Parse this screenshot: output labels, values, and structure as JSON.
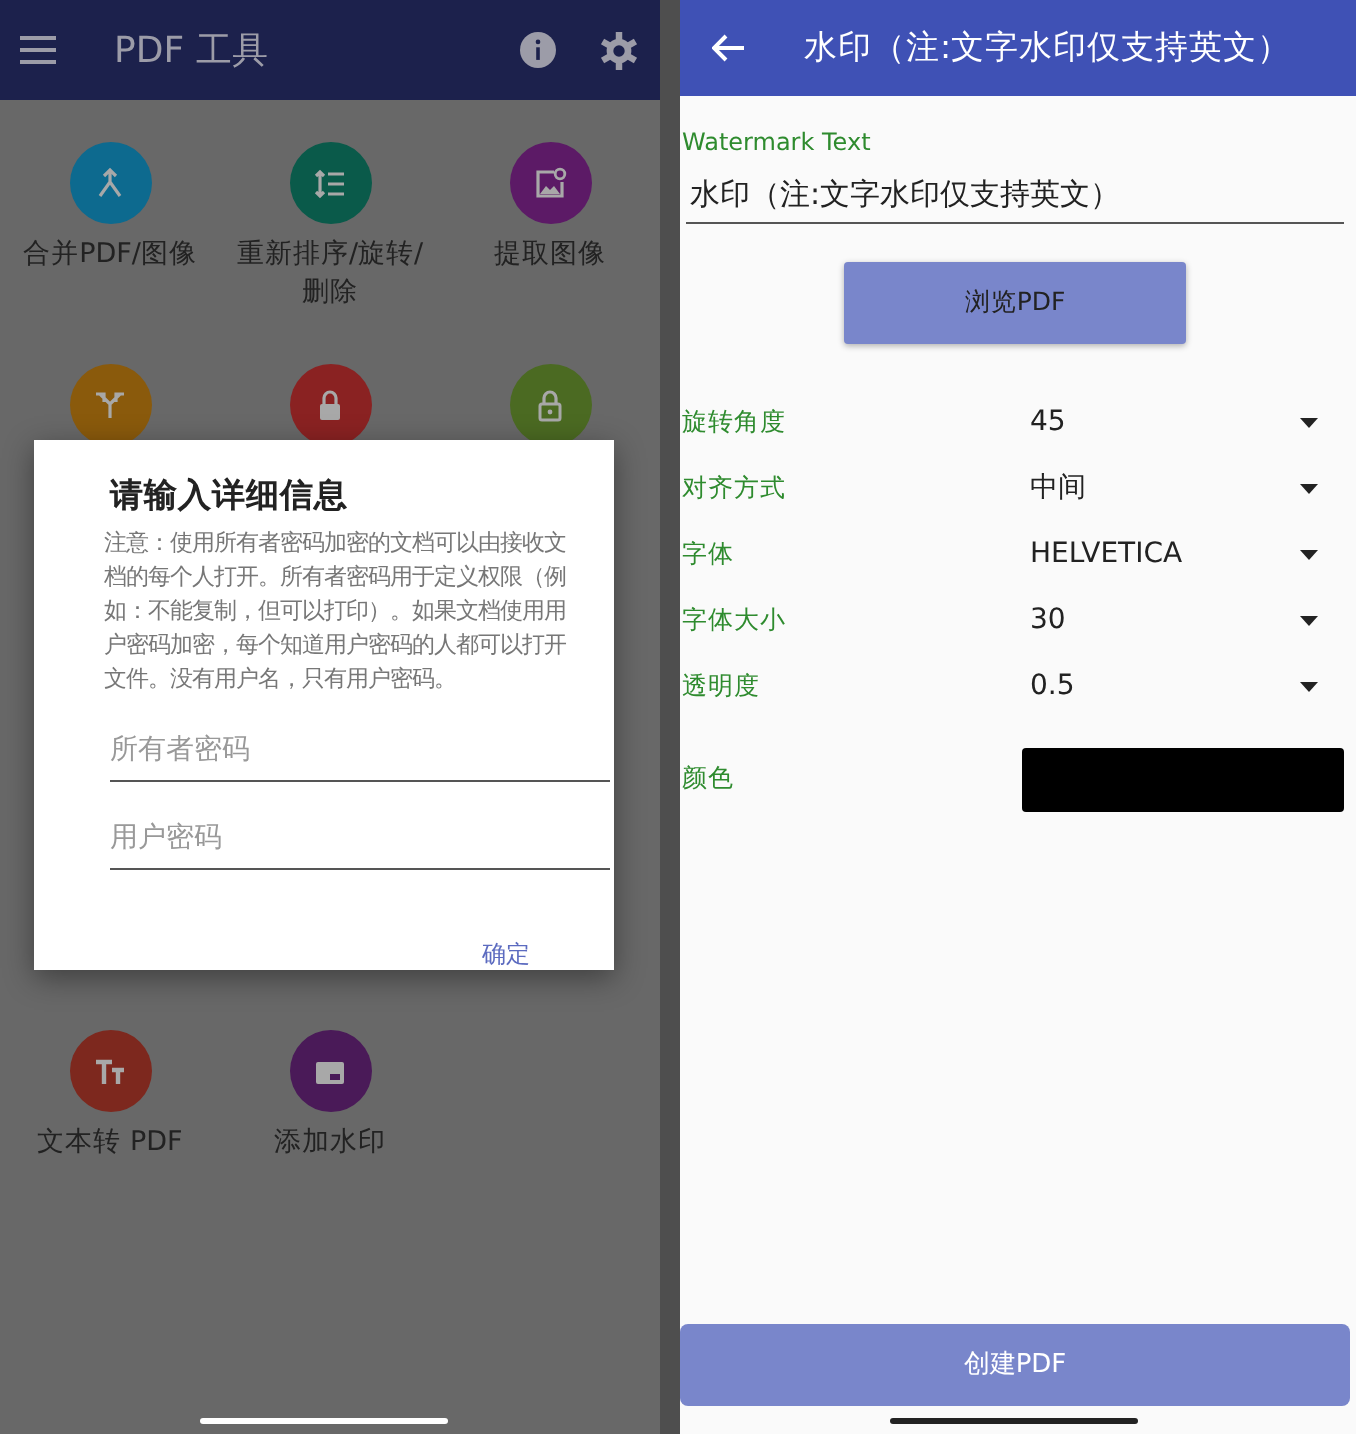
{
  "left_screen": {
    "app_bar": {
      "title": "PDF 工具"
    },
    "tools": [
      {
        "label": "合并PDF/图像",
        "color": "#0d6a8f"
      },
      {
        "label": "重新排序/旋转/删除",
        "color": "#0a5a4a"
      },
      {
        "label": "提取图像",
        "color": "#5c1a66"
      },
      {
        "color": "#8a5a0c"
      },
      {
        "color": "#8a2222"
      },
      {
        "color": "#4b6a22"
      },
      {
        "label": "文本转 PDF",
        "color": "#7d281e"
      },
      {
        "label": "添加水印",
        "color": "#4a1a58"
      }
    ],
    "dialog": {
      "title": "请输入详细信息",
      "message": "注意：使用所有者密码加密的文档可以由接收文档的每个人打开。所有者密码用于定义权限（例如：不能复制，但可以打印）。如果文档使用用户密码加密，每个知道用户密码的人都可以打开文件。没有用户名，只有用户密码。",
      "fields": [
        {
          "placeholder": "所有者密码"
        },
        {
          "placeholder": "用户密码"
        }
      ],
      "button": "确定"
    }
  },
  "right_screen": {
    "app_bar": {
      "title": "水印（注:文字水印仅支持英文）"
    },
    "watermark_text": {
      "label": "Watermark Text",
      "value": "水印（注:文字水印仅支持英文）"
    },
    "browse_button": "浏览PDF",
    "settings": [
      {
        "kind": "dropdown",
        "label": "旋转角度",
        "value": "45"
      },
      {
        "kind": "dropdown",
        "label": "对齐方式",
        "value": "中间"
      },
      {
        "kind": "dropdown",
        "label": "字体",
        "value": "HELVETICA"
      },
      {
        "kind": "dropdown",
        "label": "字体大小",
        "value": "30"
      },
      {
        "kind": "dropdown",
        "label": "透明度",
        "value": "0.5"
      },
      {
        "kind": "color",
        "label": "颜色",
        "color": "#000000"
      }
    ],
    "create_button": "创建PDF"
  }
}
